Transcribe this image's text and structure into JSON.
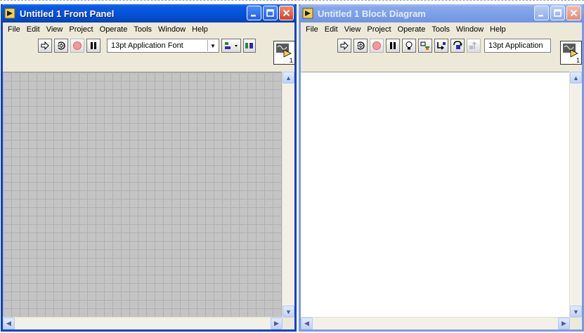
{
  "colors": {
    "title_active": "#0553d8",
    "title_inactive": "#7c9fe8",
    "close_button": "#d5431f",
    "panel_grid_bg": "#c4c4c4",
    "diagram_bg": "#ffffff",
    "chrome": "#ece9d8"
  },
  "front_panel": {
    "title": "Untitled 1 Front Panel",
    "menu": [
      "File",
      "Edit",
      "View",
      "Project",
      "Operate",
      "Tools",
      "Window",
      "Help"
    ],
    "font_select": "13pt Application Font",
    "vi_icon_number": "1",
    "icons": [
      "run-arrow-icon",
      "run-continuous-icon",
      "abort-icon",
      "pause-icon",
      "align-objects-icon",
      "distribute-objects-icon"
    ]
  },
  "block_diagram": {
    "title": "Untitled 1 Block Diagram",
    "menu": [
      "File",
      "Edit",
      "View",
      "Project",
      "Operate",
      "Tools",
      "Window",
      "Help"
    ],
    "font_select": "13pt Application",
    "vi_icon_number": "1",
    "icons": [
      "run-arrow-icon",
      "run-continuous-icon",
      "abort-icon",
      "pause-icon",
      "highlight-execution-icon",
      "retain-wire-values-icon",
      "step-into-icon",
      "step-over-icon",
      "step-out-icon"
    ]
  },
  "window_buttons": [
    "minimize-icon",
    "maximize-icon",
    "close-icon"
  ]
}
